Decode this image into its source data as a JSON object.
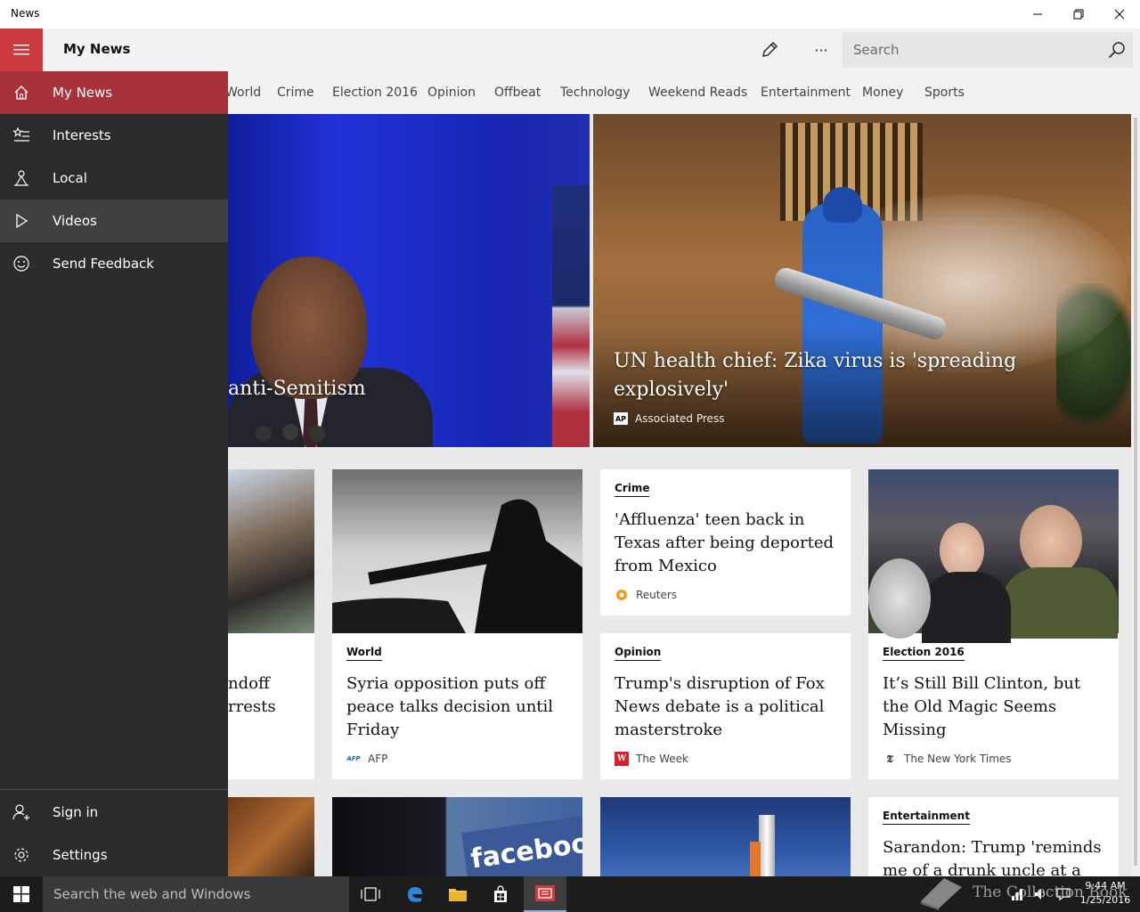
{
  "window": {
    "title": "News"
  },
  "header": {
    "app_title": "My News",
    "search_placeholder": "Search",
    "more_label": "···"
  },
  "categories": [
    "World",
    "Crime",
    "Election 2016",
    "Opinion",
    "Offbeat",
    "Technology",
    "Weekend Reads",
    "Entertainment",
    "Money",
    "Sports"
  ],
  "sidebar": {
    "items": [
      {
        "label": "My News",
        "icon": "home-icon"
      },
      {
        "label": "Interests",
        "icon": "interests-icon"
      },
      {
        "label": "Local",
        "icon": "local-icon"
      },
      {
        "label": "Videos",
        "icon": "play-icon"
      },
      {
        "label": "Send Feedback",
        "icon": "smiley-icon"
      }
    ],
    "bottom": [
      {
        "label": "Sign in",
        "icon": "person-add-icon"
      },
      {
        "label": "Settings",
        "icon": "gear-icon"
      }
    ]
  },
  "hero": {
    "left_headline": "anti-Semitism",
    "right_headline": "UN health chief: Zika virus is 'spreading explosively'",
    "right_source": "Associated Press",
    "right_source_logo": "AP"
  },
  "cards": {
    "left_partial_headline": "ndoff\nrrests",
    "world": {
      "category": "World",
      "headline": "Syria opposition puts off peace talks decision until Friday",
      "source": "AFP",
      "logo": "AFP"
    },
    "crime": {
      "category": "Crime",
      "headline": "'Affluenza' teen back in Texas after being deported from Mexico",
      "source": "Reuters"
    },
    "opinion": {
      "category": "Opinion",
      "headline": "Trump's disruption of Fox News debate is a political masterstroke",
      "source": "The Week",
      "logo": "W"
    },
    "election": {
      "category": "Election 2016",
      "headline": "It’s Still Bill Clinton, but the Old Magic Seems Missing",
      "source": "The New York Times",
      "logo": "𝕿"
    },
    "entertainment": {
      "category": "Entertainment",
      "headline": "Sarandon: Trump 'reminds me of a drunk uncle at a"
    },
    "facebook_text": "facebook"
  },
  "taskbar": {
    "search_placeholder": "Search the web and Windows",
    "time": "9:44 AM",
    "date": "1/25/2016"
  },
  "watermark": "The Collection Book",
  "colors": {
    "accent": "#cc3a3f",
    "active_nav": "#a8323a",
    "sidebar_bg": "#2b2b2b"
  }
}
